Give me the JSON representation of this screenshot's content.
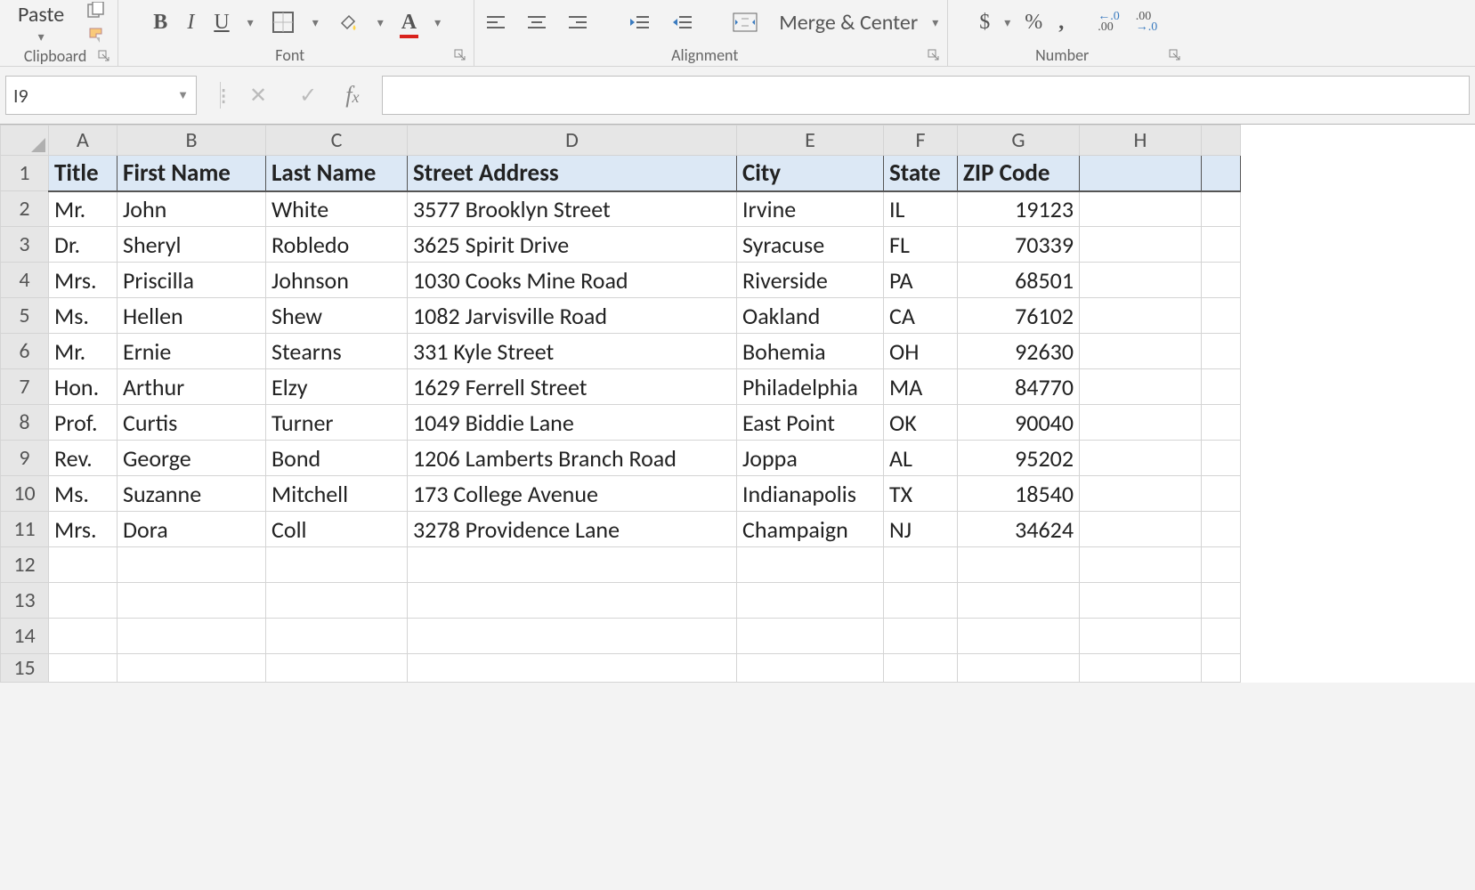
{
  "ribbon": {
    "clipboard": {
      "paste": "Paste",
      "group_label": "Clipboard"
    },
    "font": {
      "group_label": "Font"
    },
    "alignment": {
      "merge_center": "Merge & Center",
      "group_label": "Alignment"
    },
    "number": {
      "dollar": "$",
      "percent": "%",
      "comma": ",",
      "group_label": "Number"
    }
  },
  "formula_bar": {
    "cell_reference": "I9",
    "formula": ""
  },
  "columns": [
    "A",
    "B",
    "C",
    "D",
    "E",
    "F",
    "G",
    "H"
  ],
  "empty_rows_after_data": [
    12,
    13,
    14
  ],
  "data": {
    "headers": [
      "Title",
      "First Name",
      "Last Name",
      "Street Address",
      "City",
      "State",
      "ZIP Code"
    ],
    "rows": [
      {
        "title": "Mr.",
        "first": "John",
        "last": "White",
        "street": "3577 Brooklyn Street",
        "city": "Irvine",
        "state": "IL",
        "zip": "19123"
      },
      {
        "title": "Dr.",
        "first": "Sheryl",
        "last": "Robledo",
        "street": "3625 Spirit Drive",
        "city": "Syracuse",
        "state": "FL",
        "zip": "70339"
      },
      {
        "title": "Mrs.",
        "first": "Priscilla",
        "last": "Johnson",
        "street": "1030 Cooks Mine Road",
        "city": "Riverside",
        "state": "PA",
        "zip": "68501"
      },
      {
        "title": "Ms.",
        "first": "Hellen",
        "last": "Shew",
        "street": "1082 Jarvisville Road",
        "city": "Oakland",
        "state": "CA",
        "zip": "76102"
      },
      {
        "title": "Mr.",
        "first": "Ernie",
        "last": "Stearns",
        "street": "331 Kyle Street",
        "city": "Bohemia",
        "state": "OH",
        "zip": "92630"
      },
      {
        "title": "Hon.",
        "first": "Arthur",
        "last": "Elzy",
        "street": "1629 Ferrell Street",
        "city": "Philadelphia",
        "state": "MA",
        "zip": "84770"
      },
      {
        "title": "Prof.",
        "first": "Curtis",
        "last": "Turner",
        "street": "1049 Biddie Lane",
        "city": "East Point",
        "state": "OK",
        "zip": "90040"
      },
      {
        "title": "Rev.",
        "first": "George",
        "last": "Bond",
        "street": "1206 Lamberts Branch Road",
        "city": "Joppa",
        "state": "AL",
        "zip": "95202"
      },
      {
        "title": "Ms.",
        "first": "Suzanne",
        "last": "Mitchell",
        "street": "173 College Avenue",
        "city": "Indianapolis",
        "state": "TX",
        "zip": "18540"
      },
      {
        "title": "Mrs.",
        "first": "Dora",
        "last": "Coll",
        "street": "3278 Providence Lane",
        "city": "Champaign",
        "state": "NJ",
        "zip": "34624"
      }
    ]
  }
}
